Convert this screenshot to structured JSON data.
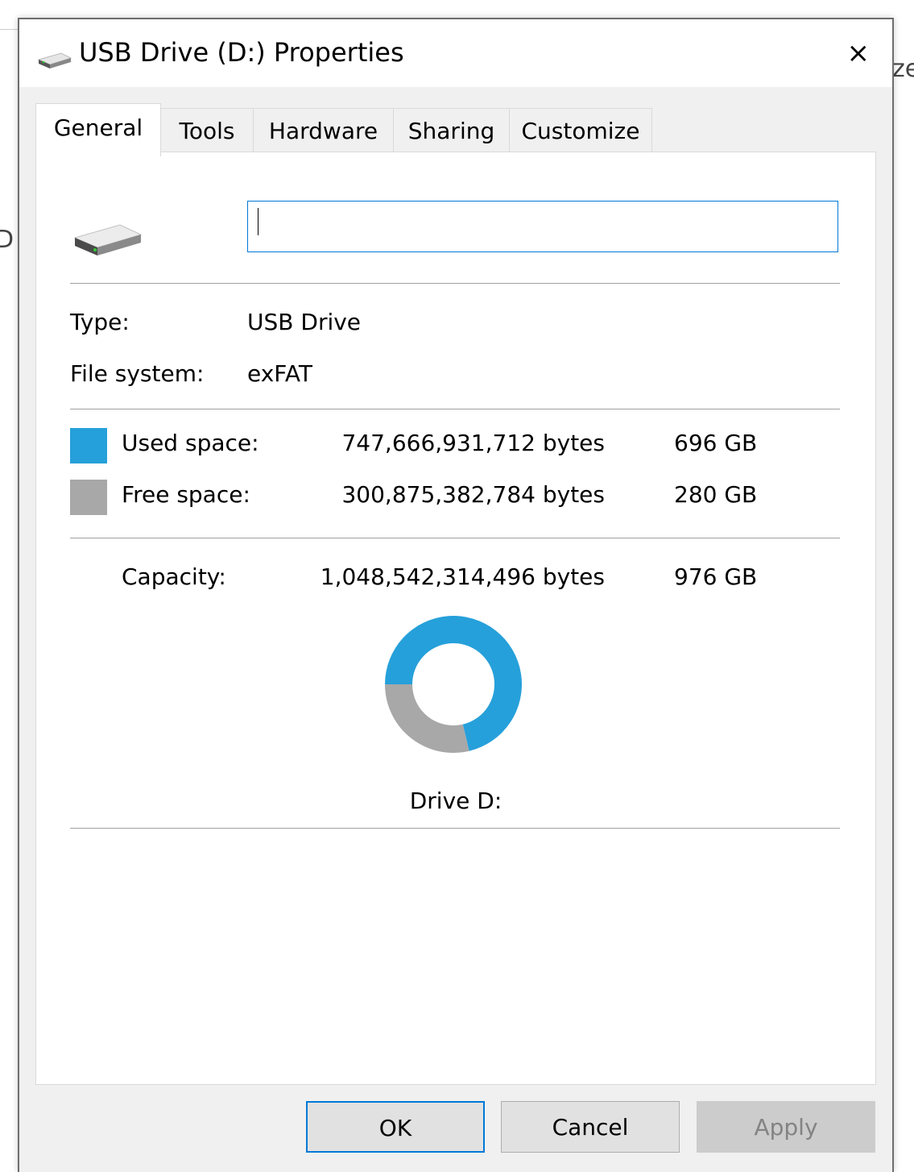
{
  "background": {
    "left_fragment": "D",
    "right_fragment": "ze"
  },
  "window": {
    "title": "USB Drive (D:) Properties",
    "close_label": "×"
  },
  "tabs": [
    {
      "label": "General"
    },
    {
      "label": "Tools"
    },
    {
      "label": "Hardware"
    },
    {
      "label": "Sharing"
    },
    {
      "label": "Customize"
    }
  ],
  "general": {
    "name_value": "",
    "type_label": "Type:",
    "type_value": "USB Drive",
    "fs_label": "File system:",
    "fs_value": "exFAT",
    "used_label": "Used space:",
    "used_bytes": "747,666,931,712 bytes",
    "used_gb": "696 GB",
    "free_label": "Free space:",
    "free_bytes": "300,875,382,784 bytes",
    "free_gb": "280 GB",
    "capacity_label": "Capacity:",
    "capacity_bytes": "1,048,542,314,496 bytes",
    "capacity_gb": "976 GB",
    "drive_label": "Drive D:"
  },
  "colors": {
    "used": "#26a0da",
    "free": "#a8a8a8"
  },
  "chart_data": {
    "type": "pie",
    "labels": [
      "Used space",
      "Free space"
    ],
    "values": [
      747666931712,
      300875382784
    ]
  },
  "buttons": {
    "ok": "OK",
    "cancel": "Cancel",
    "apply": "Apply"
  }
}
